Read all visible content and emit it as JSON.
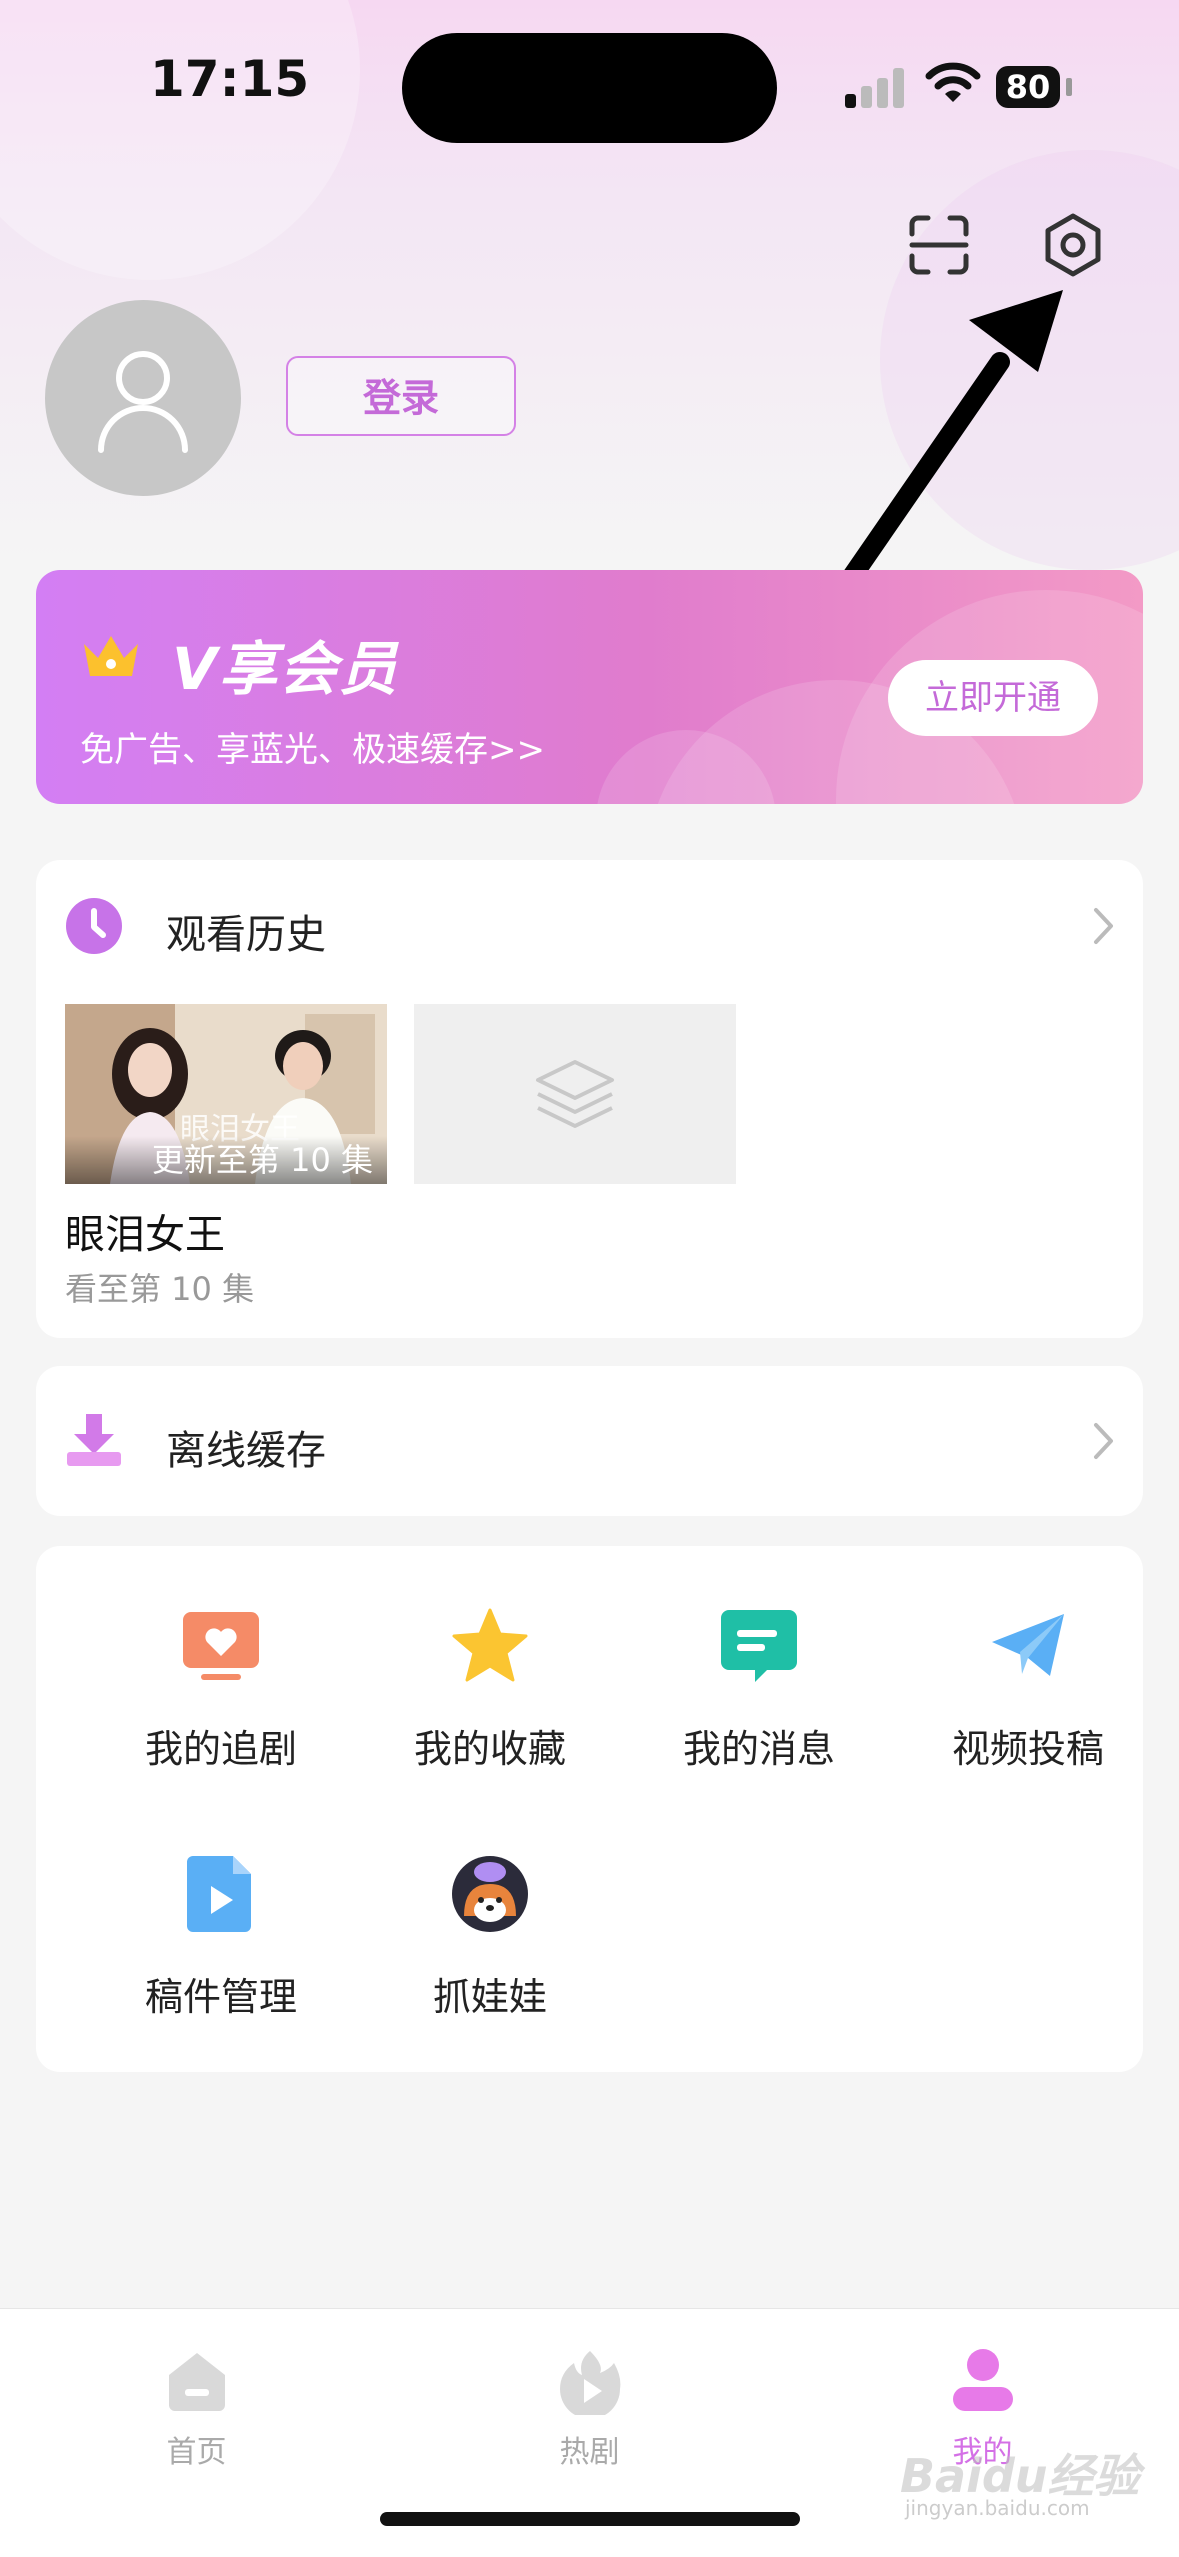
{
  "status_bar": {
    "time": "17:15",
    "battery": "80"
  },
  "profile": {
    "login_label": "登录"
  },
  "vip": {
    "title": "V享会员",
    "subtitle": "免广告、享蓝光、极速缓存>>",
    "button_label": "立即开通",
    "icon": "crown-icon"
  },
  "history": {
    "title": "观看历史",
    "items": [
      {
        "thumb_caption": "更新至第 10 集",
        "thumb_title_overlay": "眼泪女王",
        "name": "眼泪女王",
        "progress": "看至第 10 集"
      }
    ]
  },
  "offline": {
    "title": "离线缓存"
  },
  "features": [
    {
      "label": "我的追剧",
      "icon": "tv-heart-icon",
      "color": "#f58b67"
    },
    {
      "label": "我的收藏",
      "icon": "star-icon",
      "color": "#fbc531"
    },
    {
      "label": "我的消息",
      "icon": "message-icon",
      "color": "#1fbfa6"
    },
    {
      "label": "视频投稿",
      "icon": "paper-plane-icon",
      "color": "#5aaff5"
    },
    {
      "label": "稿件管理",
      "icon": "video-file-icon",
      "color": "#5aaff5"
    },
    {
      "label": "抓娃娃",
      "icon": "claw-machine-mascot-icon",
      "color": "#e8843c"
    }
  ],
  "tabbar": [
    {
      "label": "首页",
      "icon": "home-icon",
      "active": false
    },
    {
      "label": "热剧",
      "icon": "flame-play-icon",
      "active": false
    },
    {
      "label": "我的",
      "icon": "profile-icon",
      "active": true
    }
  ],
  "colors": {
    "accent": "#c46ad8",
    "inactive_tab": "#aaaaaa"
  },
  "watermark": {
    "text": "Baidu经验",
    "sub": "jingyan.baidu.com"
  }
}
